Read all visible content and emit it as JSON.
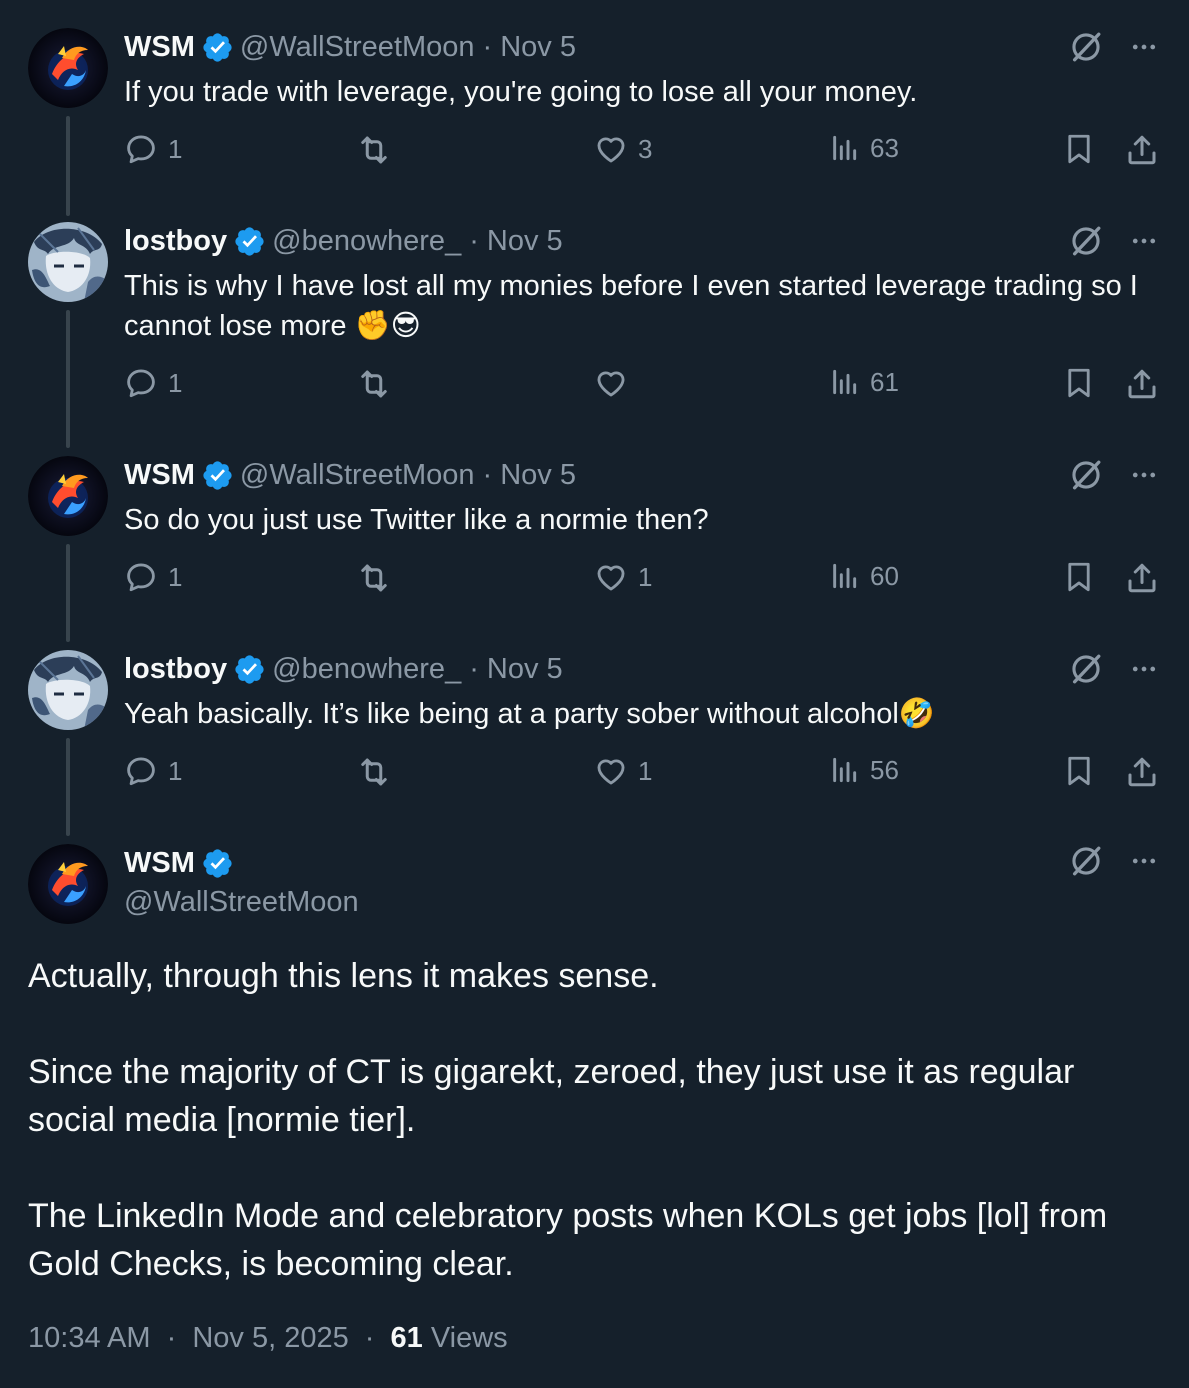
{
  "colors": {
    "background": "#15202b",
    "text": "#f7f9f9",
    "muted": "#8b98a5",
    "verified": "#1d9bf0",
    "thread_line": "#38444d"
  },
  "replies": [
    {
      "name": "WSM",
      "handle": "@WallStreetMoon",
      "date": "Nov 5",
      "avatar": "phoenix-avatar",
      "text": "If you trade with leverage, you're going to lose all your money.",
      "reply_count": "1",
      "retweet_count": "",
      "like_count": "3",
      "view_count": "63"
    },
    {
      "name": "lostboy",
      "handle": "@benowhere_",
      "date": "Nov 5",
      "avatar": "anime-avatar",
      "text": "This is why I have lost all my monies before I even started leverage trading so I cannot lose more ✊😎",
      "reply_count": "1",
      "retweet_count": "",
      "like_count": "",
      "view_count": "61"
    },
    {
      "name": "WSM",
      "handle": "@WallStreetMoon",
      "date": "Nov 5",
      "avatar": "phoenix-avatar",
      "text": "So do you just use Twitter like a normie then?",
      "reply_count": "1",
      "retweet_count": "",
      "like_count": "1",
      "view_count": "60"
    },
    {
      "name": "lostboy",
      "handle": "@benowhere_",
      "date": "Nov 5",
      "avatar": "anime-avatar",
      "text": "Yeah basically. It’s like being at a party sober without alcohol🤣",
      "reply_count": "1",
      "retweet_count": "",
      "like_count": "1",
      "view_count": "56"
    }
  ],
  "main": {
    "name": "WSM",
    "handle": "@WallStreetMoon",
    "paragraphs": [
      "Actually, through this lens it makes sense.",
      "Since the majority of CT is gigarekt, zeroed, they just use it as regular social media [normie tier].",
      "The LinkedIn Mode and celebratory posts when KOLs get jobs [lol] from Gold Checks, is becoming clear."
    ],
    "time": "10:34 AM",
    "date": "Nov 5, 2025",
    "views_count": "61",
    "views_label": "Views"
  },
  "separator": "·"
}
